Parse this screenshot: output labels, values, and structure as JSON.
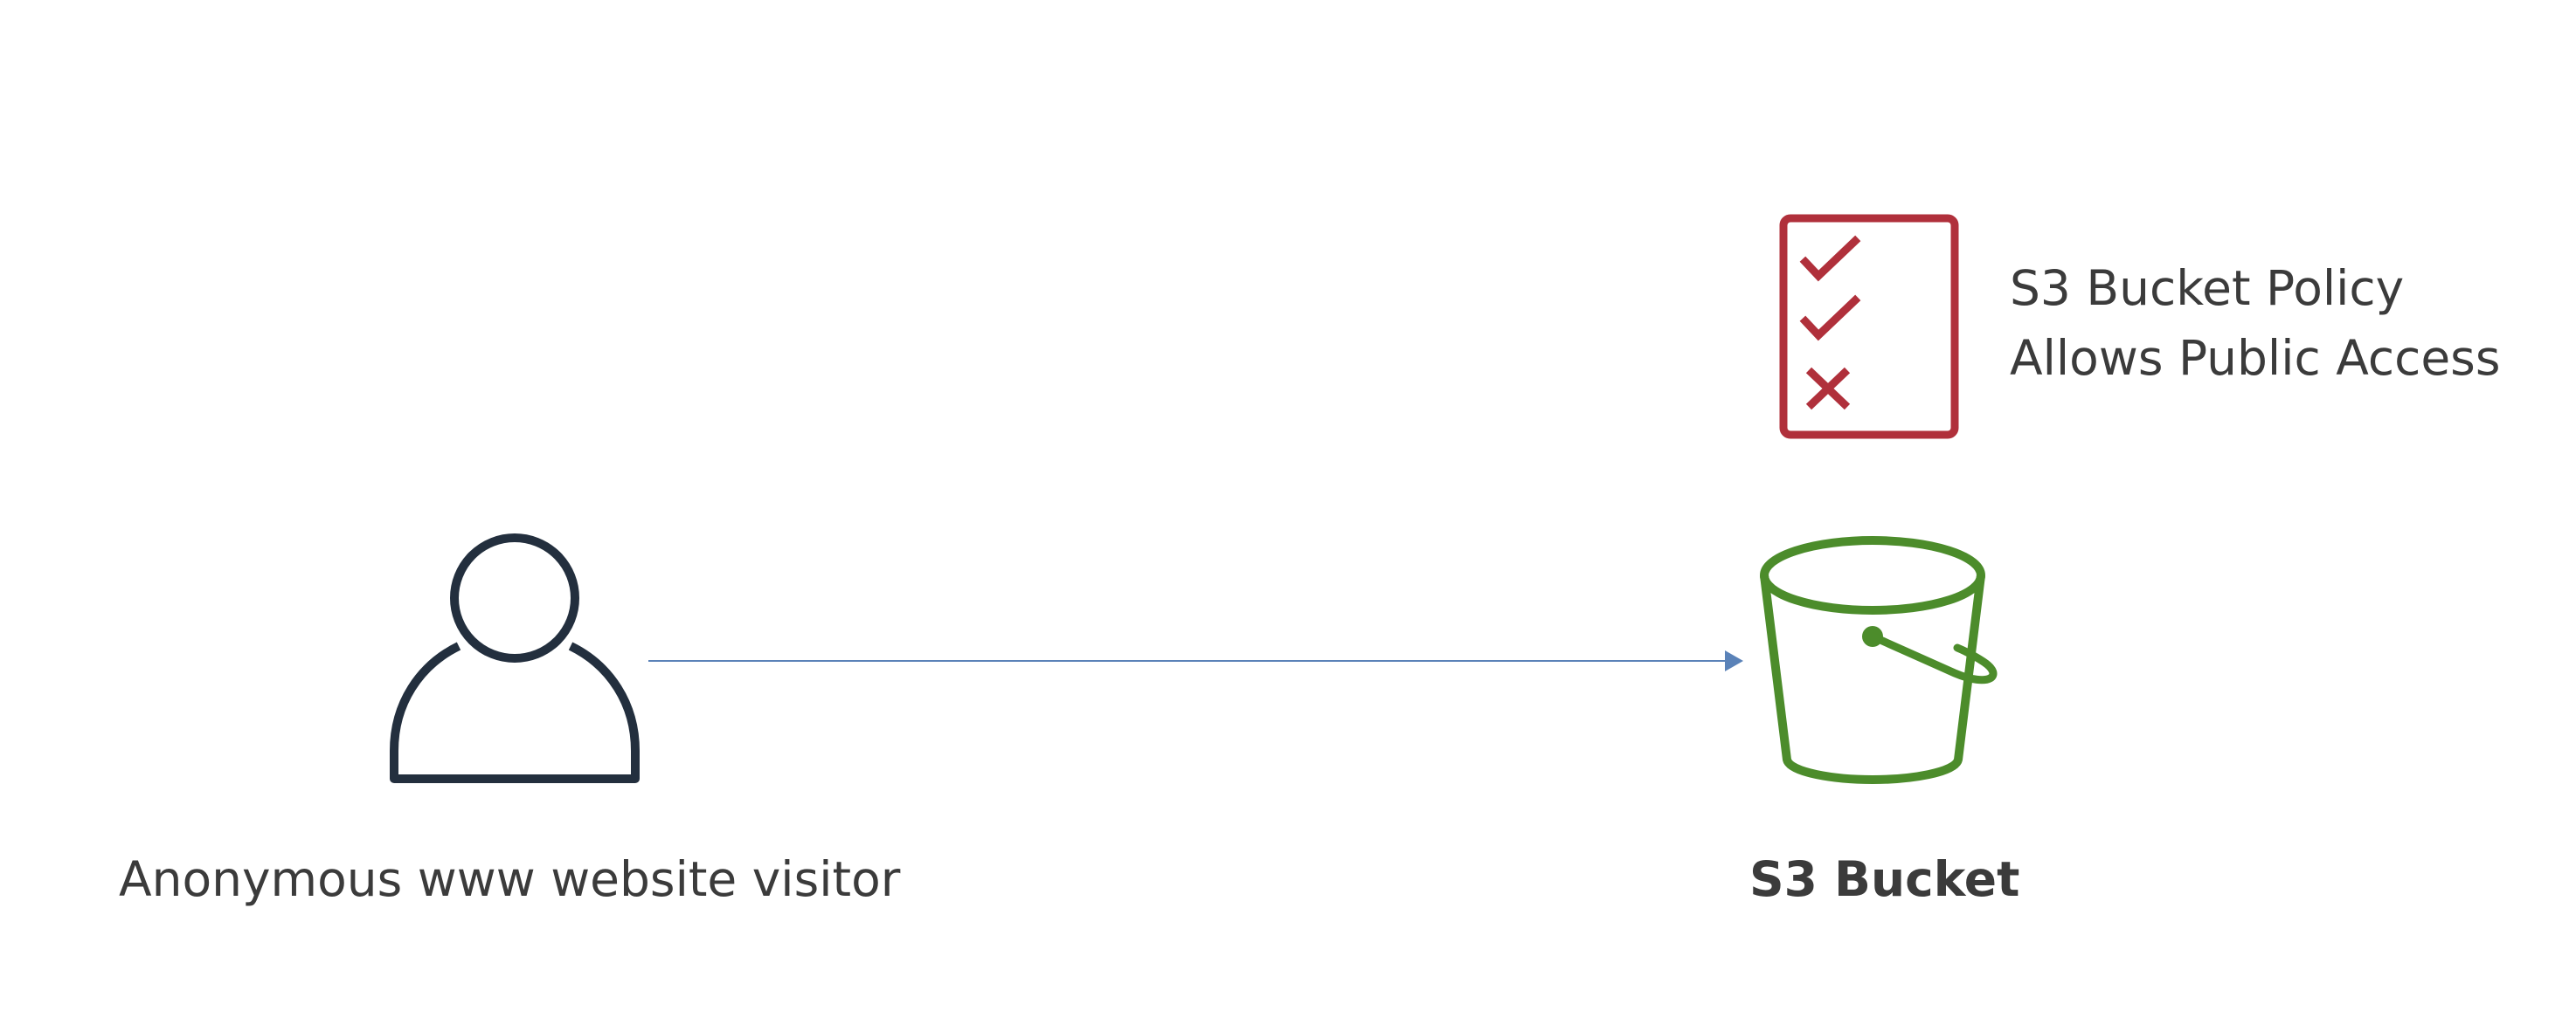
{
  "visitor": {
    "label": "Anonymous www website visitor",
    "icon": "user-icon",
    "color": "#232F3E"
  },
  "bucket": {
    "label": "S3 Bucket",
    "icon": "bucket-icon",
    "color": "#4C8C2B"
  },
  "policy": {
    "line1": "S3 Bucket Policy",
    "line2": "Allows Public Access",
    "icon": "checklist-icon",
    "color": "#B0303B",
    "items": [
      "check",
      "check",
      "cross"
    ]
  },
  "connector": {
    "color": "#5A82B8",
    "from": "visitor",
    "to": "bucket"
  }
}
